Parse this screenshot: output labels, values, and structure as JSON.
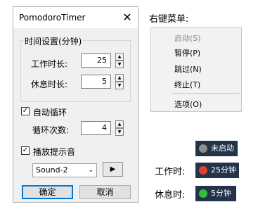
{
  "dialog": {
    "title": "PomodoroTimer",
    "close_glyph": "✕",
    "group_title": "时间设置(分钟)",
    "work_label": "工作时长:",
    "work_value": "25",
    "rest_label": "休息时长:",
    "rest_value": "5",
    "auto_loop_label": "自动循环",
    "auto_loop_checked": true,
    "loop_count_label": "循环次数:",
    "loop_count_value": "4",
    "play_sound_label": "播放提示音",
    "play_sound_checked": true,
    "sound_selected": "Sound-2",
    "play_glyph": "▶",
    "ok_label": "确定",
    "cancel_label": "取消",
    "check_glyph": "✓",
    "spin_up_glyph": "▲",
    "spin_down_glyph": "▼",
    "chevron_glyph": "⌄"
  },
  "context_menu": {
    "heading": "右键菜单:",
    "items": [
      {
        "label": "启动(S)",
        "enabled": false
      },
      {
        "label": "暂停(P)",
        "enabled": true
      },
      {
        "label": "跳过(N)",
        "enabled": true
      },
      {
        "label": "终止(T)",
        "enabled": true
      },
      {
        "label": "选项(O)",
        "enabled": true
      }
    ]
  },
  "tray_states": {
    "idle": {
      "text": "未启动",
      "dot_color": "#8e8e8e"
    },
    "work": {
      "label": "工作时:",
      "text": "25分钟",
      "dot_color": "#e2412b"
    },
    "rest": {
      "label": "休息时:",
      "text": "5分钟",
      "dot_color": "#2fbf3a"
    }
  },
  "colors": {
    "tray_bg": "#22334a",
    "accent": "#0078d7"
  }
}
